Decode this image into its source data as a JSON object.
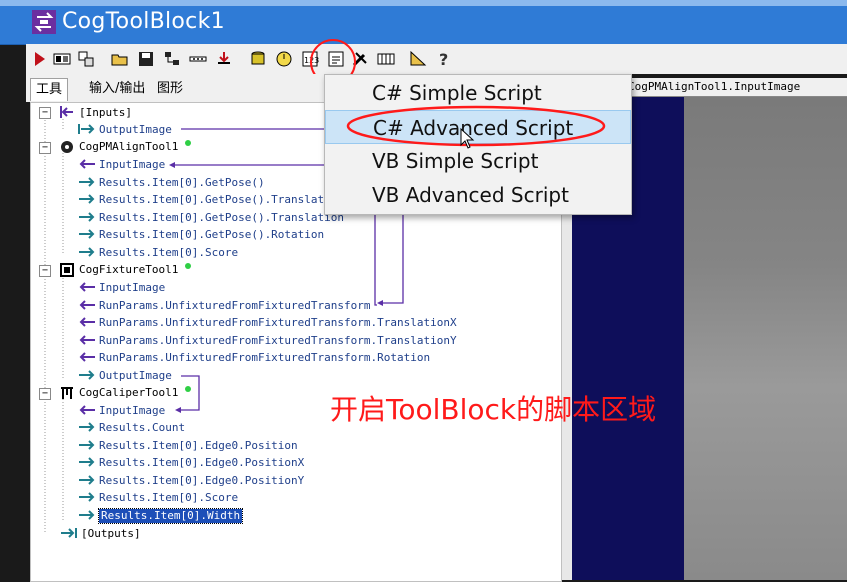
{
  "window": {
    "title": "CogToolBlock1"
  },
  "tabs": [
    {
      "label": "工具"
    },
    {
      "label": "输入/输出"
    },
    {
      "label": "图形"
    }
  ],
  "image_panel": {
    "title": "CogPMAlignTool1.InputImage"
  },
  "context_menu": {
    "items": [
      {
        "label": "C# Simple Script"
      },
      {
        "label": "C# Advanced Script"
      },
      {
        "label": "VB Simple Script"
      },
      {
        "label": "VB Advanced Script"
      }
    ],
    "highlighted_index": 1
  },
  "tree": {
    "inputs": {
      "label": "[Inputs]",
      "children": [
        "OutputImage"
      ]
    },
    "pmalign": {
      "label": "CogPMAlignTool1",
      "children": [
        "InputImage",
        "Results.Item[0].GetPose()",
        "Results.Item[0].GetPose().Translat",
        "Results.Item[0].GetPose().Translation",
        "Results.Item[0].GetPose().Rotation",
        "Results.Item[0].Score"
      ]
    },
    "fixture": {
      "label": "CogFixtureTool1",
      "children": [
        "InputImage",
        "RunParams.UnfixturedFromFixturedTransform",
        "RunParams.UnfixturedFromFixturedTransform.TranslationX",
        "RunParams.UnfixturedFromFixturedTransform.TranslationY",
        "RunParams.UnfixturedFromFixturedTransform.Rotation",
        "OutputImage"
      ]
    },
    "caliper": {
      "label": "CogCaliperTool1",
      "children": [
        "InputImage",
        "Results.Count",
        "Results.Item[0].Edge0.Position",
        "Results.Item[0].Edge0.PositionX",
        "Results.Item[0].Edge0.PositionY",
        "Results.Item[0].Score",
        "Results.Item[0].Width"
      ]
    },
    "outputs": {
      "label": "[Outputs]"
    }
  },
  "annotation": {
    "text": "开启ToolBlock的脚本区域"
  },
  "colors": {
    "title_bar": "#2f7bd6",
    "menu_highlight": "#cce4f7",
    "annotation_red": "#ff1a1a",
    "link_purple": "#5a2ea6",
    "arrow_teal": "#1f7d8c",
    "status_green": "#2fcf45"
  },
  "icons": {
    "toolbar": [
      "run-icon",
      "display-icon",
      "layout-icon",
      "open-folder-icon",
      "save-icon",
      "network-icon",
      "dots-icon",
      "import-icon",
      "database-icon",
      "timer-icon",
      "calculator-icon",
      "script-icon",
      "tools-icon",
      "grid-icon",
      "ruler-icon",
      "help-icon"
    ]
  }
}
